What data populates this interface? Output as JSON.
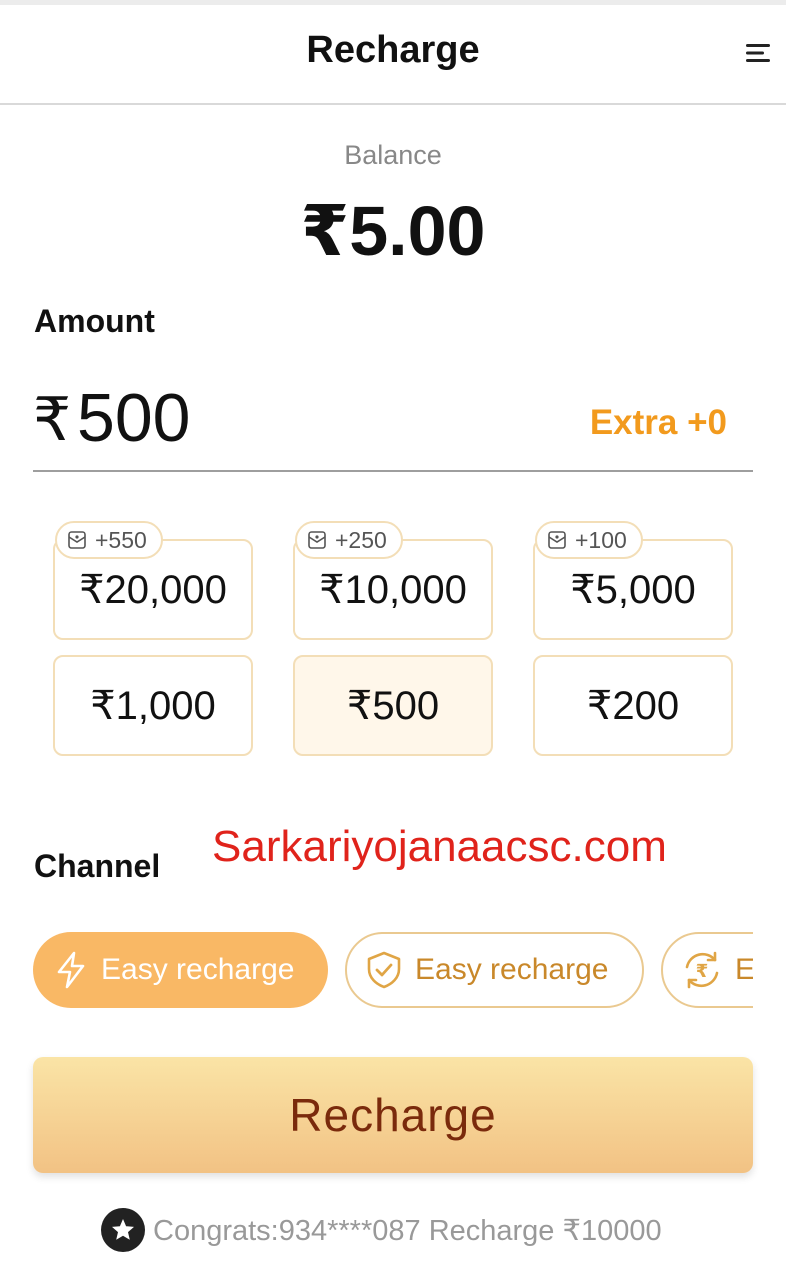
{
  "header": {
    "title": "Recharge",
    "menu_icon": "hamburger-menu-icon"
  },
  "balance": {
    "label": "Balance",
    "value": "₹5.00"
  },
  "amount": {
    "label": "Amount",
    "currency_symbol": "₹",
    "value": "500",
    "extra_text": "Extra +0"
  },
  "quick_amounts": [
    {
      "label": "₹20,000",
      "bonus": "+550",
      "selected": false
    },
    {
      "label": "₹10,000",
      "bonus": "+250",
      "selected": false
    },
    {
      "label": "₹5,000",
      "bonus": "+100",
      "selected": false
    },
    {
      "label": "₹1,000",
      "selected": false
    },
    {
      "label": "₹500",
      "selected": true
    },
    {
      "label": "₹200",
      "selected": false
    }
  ],
  "channel": {
    "label": "Channel",
    "watermark": "Sarkariyojanaacsc.com",
    "options": [
      {
        "label": "Easy recharge",
        "icon": "lightning-icon",
        "selected": true
      },
      {
        "label": "Easy recharge",
        "icon": "shield-check-icon",
        "selected": false
      },
      {
        "label": "E",
        "icon": "rupee-refresh-icon",
        "selected": false
      }
    ]
  },
  "recharge_button": {
    "label": "Recharge"
  },
  "congrats": {
    "icon": "star-badge-icon",
    "text": "Congrats:934****087 Recharge ₹10000"
  },
  "colors": {
    "accent_orange": "#f29a1d",
    "chip_selected_bg": "#f9b865",
    "chip_border": "#eac990",
    "tile_border": "#f3deb7",
    "button_gradient_top": "#fae4a6",
    "button_gradient_bottom": "#f2c284",
    "button_text": "#7a2a0c",
    "watermark_red": "#e0231b"
  }
}
